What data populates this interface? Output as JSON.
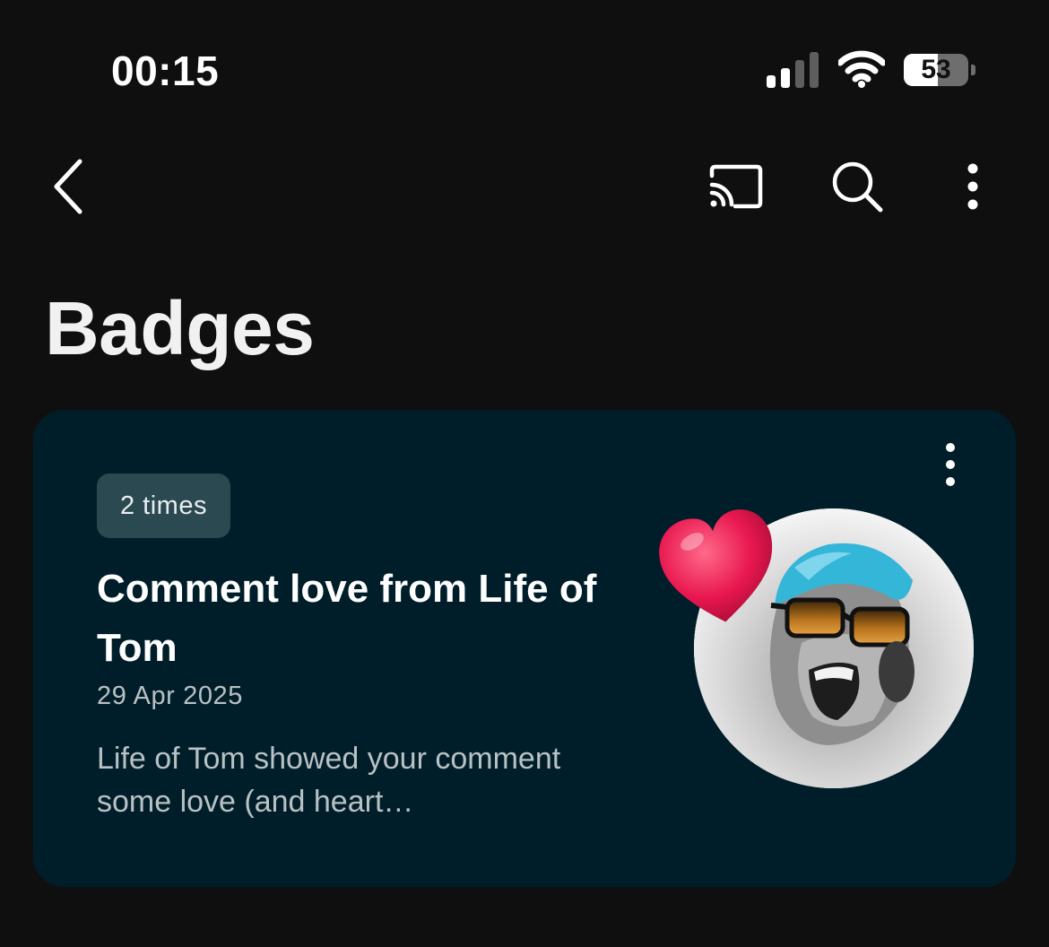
{
  "status_bar": {
    "time": "00:15",
    "battery_level": "53",
    "signal_bars_active": 2,
    "signal_bars_total": 4
  },
  "top_bar": {
    "icons": [
      "back-icon",
      "cast-icon",
      "search-icon",
      "more-vert-icon"
    ]
  },
  "page": {
    "title": "Badges"
  },
  "badge_card": {
    "count_label": "2 times",
    "title": "Comment love from Life of Tom",
    "date": "29 Apr 2025",
    "description": "Life of Tom showed your comment some love (and heart…",
    "overlay_icon": "heart-icon",
    "menu_icon": "more-vert-icon"
  },
  "colors": {
    "background": "#0f0f0f",
    "card_background": "#001e29",
    "chip_background": "#2a4950",
    "heart": "#e8174f",
    "text_primary": "#ffffff",
    "text_secondary": "#b8c1c4"
  }
}
